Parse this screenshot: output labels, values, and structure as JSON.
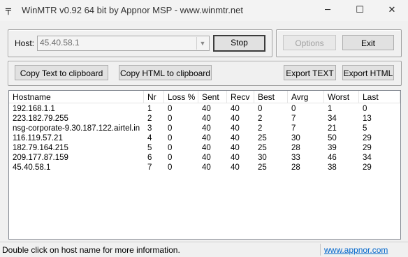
{
  "window": {
    "title": "WinMTR v0.92 64 bit by Appnor MSP - www.winmtr.net",
    "minimize_glyph": "─",
    "maximize_glyph": "☐",
    "close_glyph": "✕",
    "icon_glyph": "╤"
  },
  "host": {
    "label": "Host:",
    "value": "45.40.58.1"
  },
  "buttons": {
    "stop": "Stop",
    "options": "Options",
    "exit": "Exit",
    "copy_text": "Copy Text to clipboard",
    "copy_html": "Copy HTML to clipboard",
    "export_text": "Export TEXT",
    "export_html": "Export HTML"
  },
  "table": {
    "columns": [
      "Hostname",
      "Nr",
      "Loss %",
      "Sent",
      "Recv",
      "Best",
      "Avrg",
      "Worst",
      "Last"
    ],
    "rows": [
      [
        "192.168.1.1",
        "1",
        "0",
        "40",
        "40",
        "0",
        "0",
        "1",
        "0"
      ],
      [
        "223.182.79.255",
        "2",
        "0",
        "40",
        "40",
        "2",
        "7",
        "34",
        "13"
      ],
      [
        "nsg-corporate-9.30.187.122.airtel.in",
        "3",
        "0",
        "40",
        "40",
        "2",
        "7",
        "21",
        "5"
      ],
      [
        "116.119.57.21",
        "4",
        "0",
        "40",
        "40",
        "25",
        "30",
        "50",
        "29"
      ],
      [
        "182.79.164.215",
        "5",
        "0",
        "40",
        "40",
        "25",
        "28",
        "39",
        "29"
      ],
      [
        "209.177.87.159",
        "6",
        "0",
        "40",
        "40",
        "30",
        "33",
        "46",
        "34"
      ],
      [
        "45.40.58.1",
        "7",
        "0",
        "40",
        "40",
        "25",
        "28",
        "38",
        "29"
      ]
    ]
  },
  "status": {
    "message": "Double click on host name for more information.",
    "link": "www.appnor.com"
  }
}
